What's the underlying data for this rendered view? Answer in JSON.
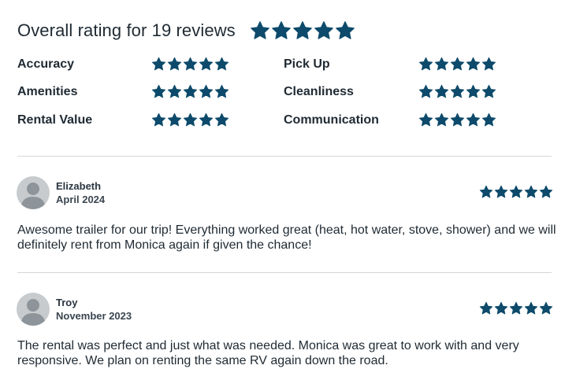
{
  "overall": {
    "title": "Overall rating for 19 reviews",
    "rating": 5,
    "max": 5
  },
  "categories": [
    {
      "label": "Accuracy",
      "rating": 5
    },
    {
      "label": "Pick Up",
      "rating": 5
    },
    {
      "label": "Amenities",
      "rating": 5
    },
    {
      "label": "Cleanliness",
      "rating": 5
    },
    {
      "label": "Rental Value",
      "rating": 5
    },
    {
      "label": "Communication",
      "rating": 5
    }
  ],
  "reviews": [
    {
      "name": "Elizabeth",
      "date": "April 2024",
      "rating": 5,
      "text": "Awesome trailer for our trip! Everything worked great (heat, hot water, stove, shower) and we will definitely rent from Monica again if given the chance!"
    },
    {
      "name": "Troy",
      "date": "November 2023",
      "rating": 5,
      "text": "The rental was perfect and just what was needed. Monica was great to work with and very responsive. We plan on renting the same RV again down the road."
    }
  ],
  "colors": {
    "star": "#0d4a6b",
    "text": "#1f2a33",
    "divider": "#d3d6d9",
    "avatar_bg": "#c7cbce",
    "avatar_fg": "#8d959b"
  },
  "icons": {
    "star": "star-icon",
    "avatar": "user-avatar-icon"
  }
}
